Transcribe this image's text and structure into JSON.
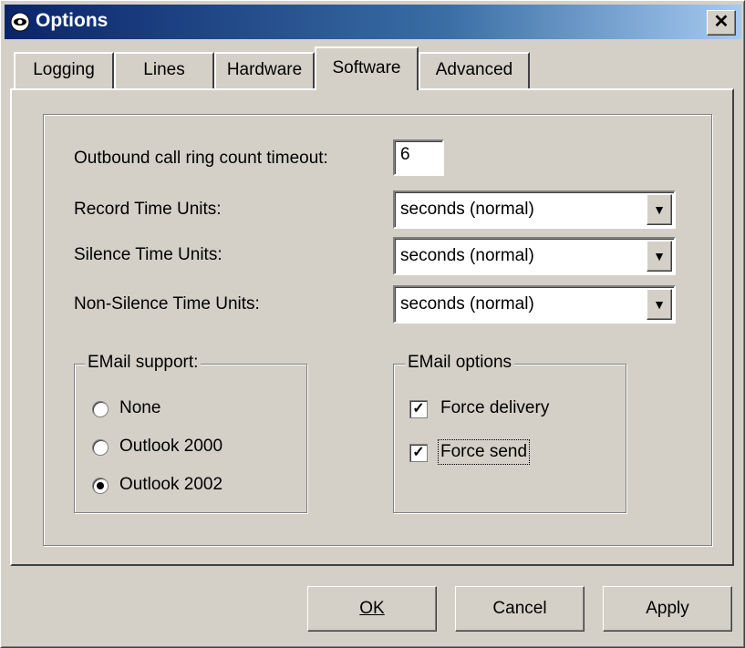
{
  "window": {
    "title": "Options",
    "close_glyph": "✕"
  },
  "tabs": [
    {
      "label": "Logging"
    },
    {
      "label": "Lines"
    },
    {
      "label": "Hardware"
    },
    {
      "label": "Software",
      "active": true
    },
    {
      "label": "Advanced"
    }
  ],
  "fields": {
    "ring_timeout": {
      "label": "Outbound call ring count timeout:",
      "value": "6"
    },
    "record_units": {
      "label": "Record Time Units:",
      "value": "seconds (normal)"
    },
    "silence_units": {
      "label": "Silence Time Units:",
      "value": "seconds (normal)"
    },
    "nonsilence_units": {
      "label": "Non-Silence Time Units:",
      "value": "seconds (normal)"
    }
  },
  "email_support": {
    "legend": "EMail support:",
    "options": [
      {
        "label": "None",
        "selected": false
      },
      {
        "label": "Outlook 2000",
        "selected": false
      },
      {
        "label": "Outlook 2002",
        "selected": true
      }
    ]
  },
  "email_options": {
    "legend": "EMail options",
    "items": [
      {
        "label": "Force delivery",
        "checked": true
      },
      {
        "label": "Force send",
        "checked": true
      }
    ]
  },
  "buttons": {
    "ok": "OK",
    "cancel": "Cancel",
    "apply": "Apply"
  },
  "colors": {
    "titlebar_start": "#0a246a",
    "titlebar_end": "#a6caf0",
    "face": "#d4d0c8"
  }
}
